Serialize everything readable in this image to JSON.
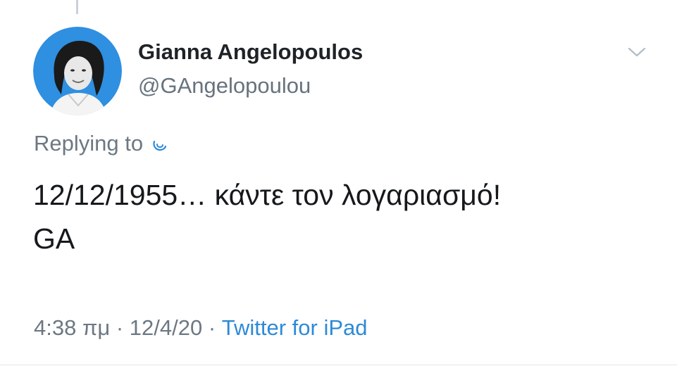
{
  "author": {
    "name": "Gianna Angelopoulos",
    "handle": "@GAngelopoulou",
    "avatar_icon": "profile-photo-avatar"
  },
  "reply": {
    "label": "Replying to"
  },
  "tweet": {
    "line1": "12/12/1955… κάντε τον λογαριασμό!",
    "line2": "GA"
  },
  "meta": {
    "time": "4:38 πμ",
    "separator1": " · ",
    "date": "12/4/20",
    "separator2": " · ",
    "source": "Twitter for iPad"
  },
  "icons": {
    "menu": "chevron-down-icon",
    "mention": "mention-fragment-icon"
  },
  "colors": {
    "text": "#16191c",
    "secondary": "#6c7883",
    "link": "#2e8ad6",
    "avatar_ring": "#2f8fe0"
  }
}
